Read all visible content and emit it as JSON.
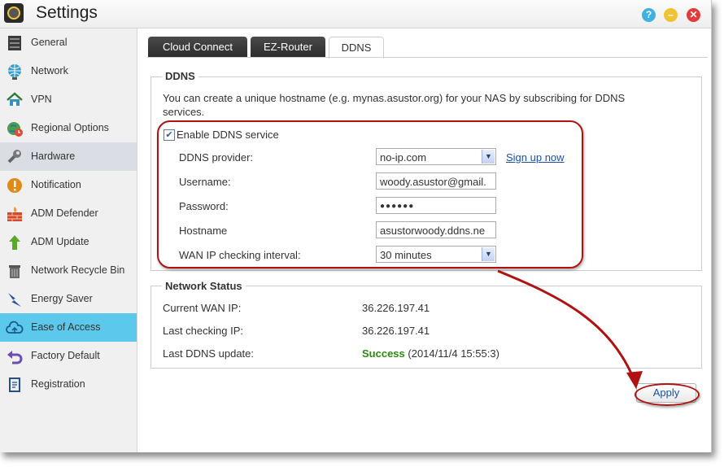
{
  "window": {
    "title": "Settings"
  },
  "sidebar": {
    "items": [
      {
        "label": "General",
        "icon": "server-icon"
      },
      {
        "label": "Network",
        "icon": "globe-icon"
      },
      {
        "label": "VPN",
        "icon": "house-network-icon"
      },
      {
        "label": "Regional Options",
        "icon": "earth-clock-icon"
      },
      {
        "label": "Hardware",
        "icon": "wrench-icon"
      },
      {
        "label": "Notification",
        "icon": "alert-icon"
      },
      {
        "label": "ADM Defender",
        "icon": "firewall-icon"
      },
      {
        "label": "ADM Update",
        "icon": "update-arrow-icon"
      },
      {
        "label": "Network Recycle Bin",
        "icon": "trash-icon"
      },
      {
        "label": "Energy Saver",
        "icon": "lightning-icon"
      },
      {
        "label": "Ease of Access",
        "icon": "cloud-icon"
      },
      {
        "label": "Factory Default",
        "icon": "undo-icon"
      },
      {
        "label": "Registration",
        "icon": "registration-icon"
      }
    ]
  },
  "tabs": [
    "Cloud Connect",
    "EZ-Router",
    "DDNS"
  ],
  "ddns": {
    "legend": "DDNS",
    "description_line1": "You can create a unique hostname (e.g. mynas.asustor.org) for your NAS by subscribing for DDNS",
    "description_line2": "services.",
    "enable_label": "Enable DDNS service",
    "enabled": true,
    "provider_label": "DDNS provider:",
    "provider_value": "no-ip.com",
    "signup_link": "Sign up now",
    "username_label": "Username:",
    "username_value": "woody.asustor@gmail.",
    "password_label": "Password:",
    "password_value": "●●●●●●",
    "hostname_label": "Hostname",
    "hostname_value": "asustorwoody.ddns.ne",
    "interval_label": "WAN IP checking interval:",
    "interval_value": "30 minutes"
  },
  "status": {
    "legend": "Network Status",
    "wan_label": "Current WAN IP:",
    "wan_value": "36.226.197.41",
    "last_check_label": "Last checking IP:",
    "last_check_value": "36.226.197.41",
    "last_update_label": "Last DDNS update:",
    "last_update_result": "Success",
    "last_update_time": "(2014/11/4 15:55:3)"
  },
  "apply_label": "Apply",
  "colors": {
    "accent": "#5bc8ec",
    "annotation": "#b01212",
    "success": "#2a8a10",
    "link": "#1a4fa8"
  }
}
